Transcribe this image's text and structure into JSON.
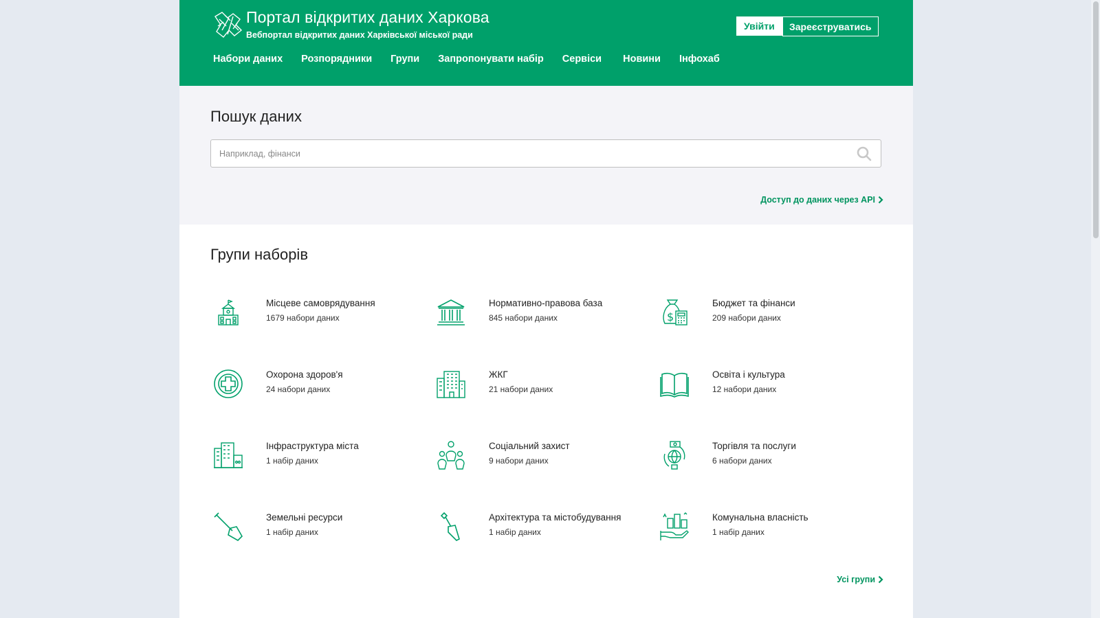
{
  "header": {
    "title": "Портал відкритих даних Харкова",
    "subtitle": "Вебпортал відкритих даних Харківської міської ради",
    "login_label": "Увійти",
    "register_label": "Зареєструватись",
    "nav": [
      "Набори даних",
      "Розпорядники",
      "Групи",
      "Запропонувати набір",
      "Сервіси",
      "Новини",
      "Інфохаб"
    ]
  },
  "search": {
    "heading": "Пошук даних",
    "placeholder": "Наприклад, фінанси",
    "value": "",
    "api_link": "Доступ до даних через API"
  },
  "groups": {
    "heading": "Групи наборів",
    "items": [
      {
        "title": "Місцеве самоврядування",
        "count": "1679 набори даних",
        "icon": "town-hall-icon"
      },
      {
        "title": "Нормативно-правова база",
        "count": "845 набори даних",
        "icon": "courthouse-icon"
      },
      {
        "title": "Бюджет та фінанси",
        "count": "209 набори даних",
        "icon": "money-bag-calculator-icon"
      },
      {
        "title": "Охорона здоров'я",
        "count": "24 набори даних",
        "icon": "medical-cross-icon"
      },
      {
        "title": "ЖКГ",
        "count": "21 набори даних",
        "icon": "apartment-building-icon"
      },
      {
        "title": "Освіта і культура",
        "count": "12 набори даних",
        "icon": "open-book-icon"
      },
      {
        "title": "Інфраструктура міста",
        "count": "1 набір даних",
        "icon": "city-buildings-icon"
      },
      {
        "title": "Соціальний захист",
        "count": "9 набори даних",
        "icon": "people-group-icon"
      },
      {
        "title": "Торгівля та послуги",
        "count": "6 набори даних",
        "icon": "globe-trade-icon"
      },
      {
        "title": "Земельні ресурси",
        "count": "1 набір даних",
        "icon": "shovel-icon"
      },
      {
        "title": "Архітектура та містобудування",
        "count": "1 набір даних",
        "icon": "trowel-icon"
      },
      {
        "title": "Комунальна власність",
        "count": "1 набір даних",
        "icon": "hand-property-icon"
      }
    ],
    "all_link": "Усі групи"
  },
  "colors": {
    "brand_green": "#00a06a",
    "link_green": "#00945f",
    "search_bg": "#f4f4f8",
    "outer_bg": "#e5eaf1"
  }
}
